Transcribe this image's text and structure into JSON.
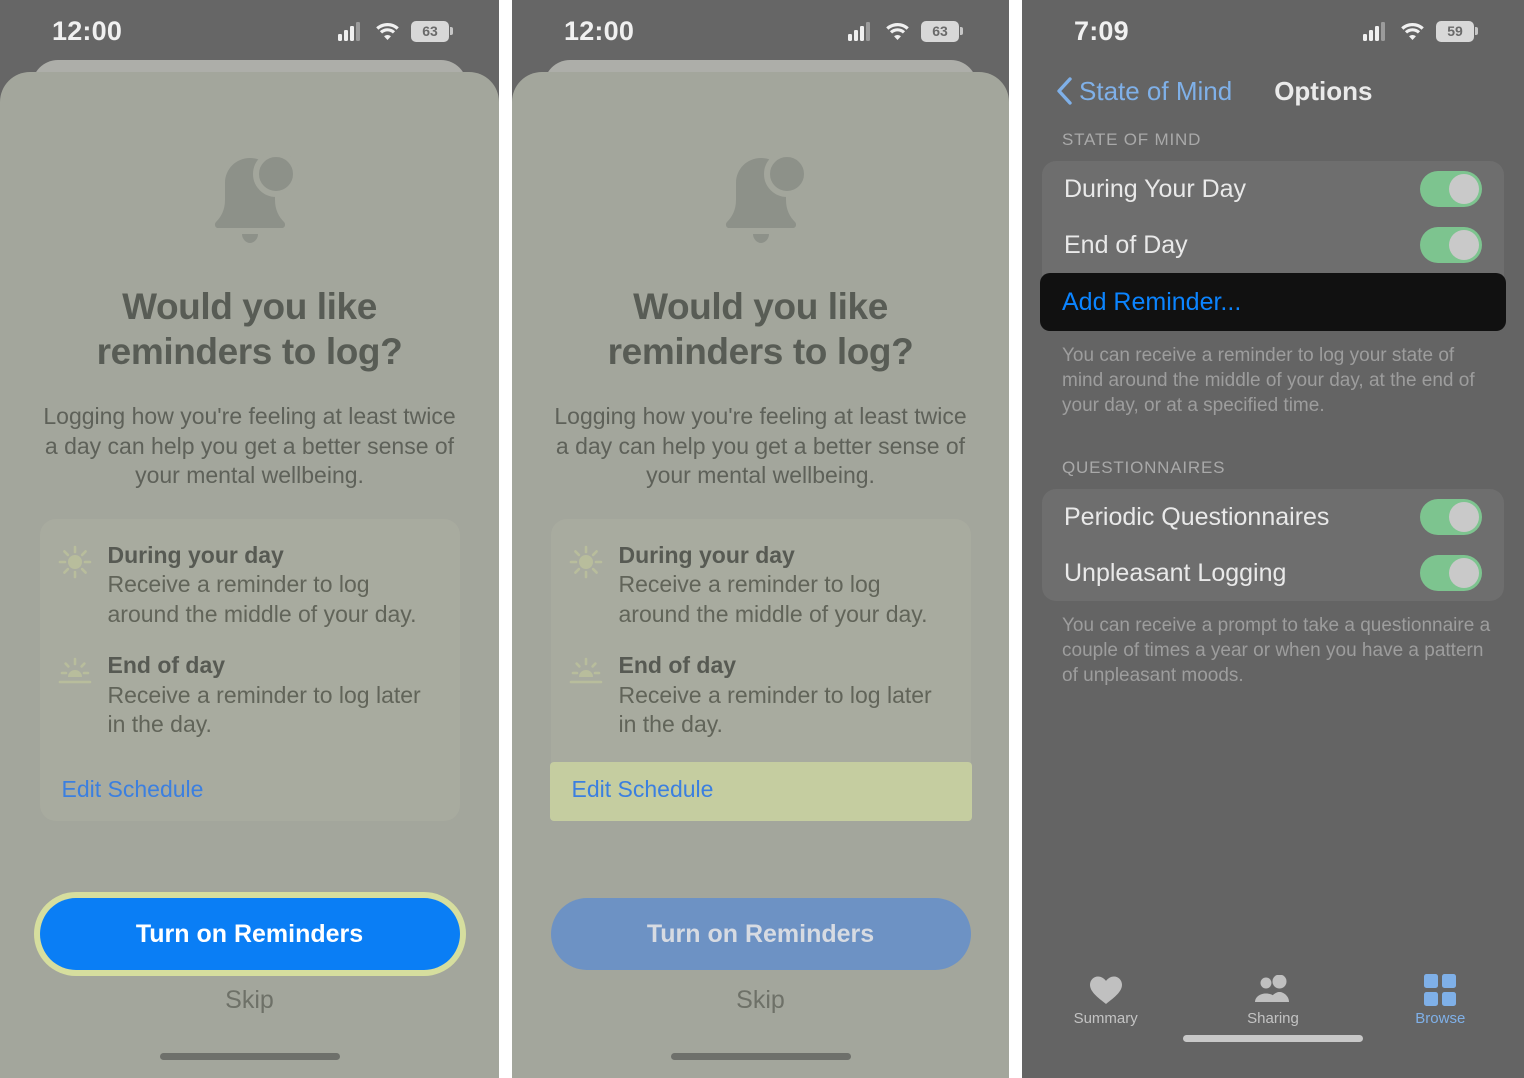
{
  "panel1": {
    "status": {
      "time": "12:00",
      "battery": "63",
      "cellular_icon": "cellular-signal-icon",
      "wifi_icon": "wifi-icon"
    },
    "bell_icon": "bell-badge-icon",
    "headline": "Would you like reminders to log?",
    "subhead": "Logging how you're feeling at least twice a day can help you get a better sense of your mental wellbeing.",
    "items": [
      {
        "icon": "sun-icon",
        "title": "During your day",
        "desc": "Receive a reminder to log around the middle of your day."
      },
      {
        "icon": "sunset-icon",
        "title": "End of day",
        "desc": "Receive a reminder to log later in the day."
      }
    ],
    "edit_link": "Edit Schedule",
    "cta": "Turn on Reminders",
    "skip": "Skip"
  },
  "panel2": {
    "status": {
      "time": "12:00",
      "battery": "63",
      "cellular_icon": "cellular-signal-icon",
      "wifi_icon": "wifi-icon"
    },
    "bell_icon": "bell-badge-icon",
    "headline": "Would you like reminders to log?",
    "subhead": "Logging how you're feeling at least twice a day can help you get a better sense of your mental wellbeing.",
    "items": [
      {
        "icon": "sun-icon",
        "title": "During your day",
        "desc": "Receive a reminder to log around the middle of your day."
      },
      {
        "icon": "sunset-icon",
        "title": "End of day",
        "desc": "Receive a reminder to log later in the day."
      }
    ],
    "edit_link": "Edit Schedule",
    "cta": "Turn on Reminders",
    "skip": "Skip"
  },
  "panel3": {
    "status": {
      "time": "7:09",
      "battery": "59",
      "cellular_icon": "cellular-signal-icon",
      "wifi_icon": "wifi-icon"
    },
    "nav": {
      "back_label": "State of Mind",
      "back_icon": "chevron-left-icon",
      "title": "Options"
    },
    "sections": [
      {
        "header": "STATE OF MIND",
        "rows": [
          {
            "label": "During Your Day",
            "type": "toggle",
            "value": "on"
          },
          {
            "label": "End of Day",
            "type": "toggle",
            "value": "on"
          },
          {
            "label": "Add Reminder...",
            "type": "action",
            "highlighted": true
          }
        ],
        "footnote": "You can receive a reminder to log your state of mind around the middle of your day, at the end of your day, or at a specified time."
      },
      {
        "header": "QUESTIONNAIRES",
        "rows": [
          {
            "label": "Periodic Questionnaires",
            "type": "toggle",
            "value": "on"
          },
          {
            "label": "Unpleasant Logging",
            "type": "toggle",
            "value": "on"
          }
        ],
        "footnote": "You can receive a prompt to take a questionnaire a couple of times a year or when you have a pattern of unpleasant moods."
      }
    ],
    "tabs": [
      {
        "label": "Summary",
        "icon": "heart-icon",
        "active": false
      },
      {
        "label": "Sharing",
        "icon": "people-icon",
        "active": false
      },
      {
        "label": "Browse",
        "icon": "grid-squares-icon",
        "active": true
      }
    ]
  },
  "colors": {
    "accent_blue": "#0a7ef5",
    "link_blue": "#3b7fe0",
    "highlight_green": "#c5cda0",
    "highlight_dark": "#111111",
    "toggle_on": "#7dc48f",
    "sheet_bg": "#a3a69c",
    "screen_bg": "#646464"
  }
}
